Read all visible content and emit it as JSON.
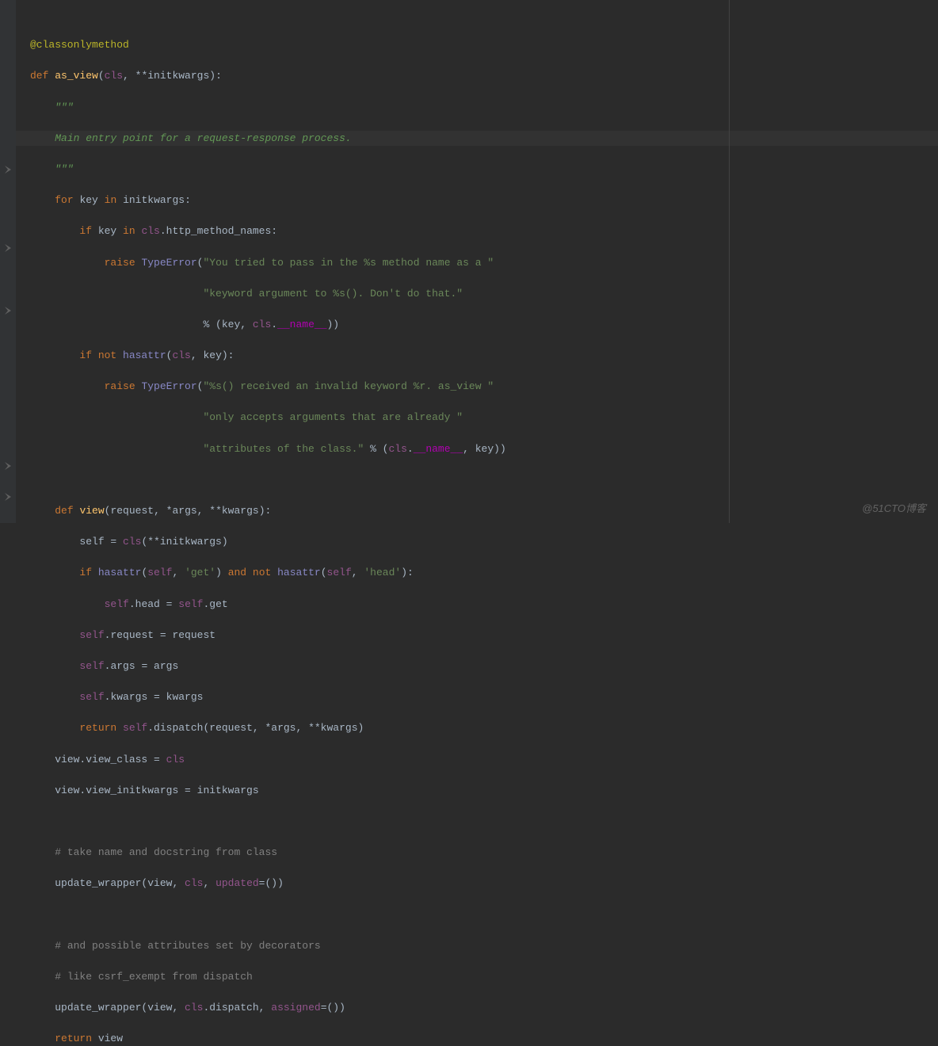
{
  "watermark": "@51CTO博客",
  "code": {
    "l1": "@classonlymethod",
    "l2_def": "def ",
    "l2_name": "as_view",
    "l2_params": "(",
    "l2_cls": "cls",
    "l2_rest": ", **initkwargs):",
    "l3": "\"\"\"",
    "l4": "Main entry point for a request-response process.",
    "l5": "\"\"\"",
    "l6_for": "for ",
    "l6_key": "key ",
    "l6_in": "in ",
    "l6_rest": "initkwargs:",
    "l7_if": "if ",
    "l7_key": "key ",
    "l7_in": "in ",
    "l7_cls": "cls",
    "l7_rest": ".http_method_names:",
    "l8_raise": "raise ",
    "l8_type": "TypeError",
    "l8_paren": "(",
    "l8_str": "\"You tried to pass in the %s method name as a \"",
    "l9_str": "\"keyword argument to %s(). Don't do that.\"",
    "l10_pct": "% (key, ",
    "l10_cls": "cls",
    "l10_dot": ".",
    "l10_name": "__name__",
    "l10_end": "))",
    "l11_if": "if not ",
    "l11_hasattr": "hasattr",
    "l11_paren": "(",
    "l11_cls": "cls",
    "l11_rest": ", key):",
    "l12_raise": "raise ",
    "l12_type": "TypeError",
    "l12_paren": "(",
    "l12_str": "\"%s() received an invalid keyword %r. as_view \"",
    "l13_str": "\"only accepts arguments that are already \"",
    "l14_str": "\"attributes of the class.\"",
    "l14_pct": " % (",
    "l14_cls": "cls",
    "l14_dot": ".",
    "l14_name": "__name__",
    "l14_end": ", key))",
    "l16_def": "def ",
    "l16_name": "view",
    "l16_params": "(request, *args, **kwargs):",
    "l17_self": "self = ",
    "l17_cls": "cls",
    "l17_rest": "(**initkwargs)",
    "l18_if": "if ",
    "l18_hasattr1": "hasattr",
    "l18_p1": "(",
    "l18_self1": "self",
    "l18_c1": ", ",
    "l18_str1": "'get'",
    "l18_p1c": ") ",
    "l18_and": "and not ",
    "l18_hasattr2": "hasattr",
    "l18_p2": "(",
    "l18_self2": "self",
    "l18_c2": ", ",
    "l18_str2": "'head'",
    "l18_p2c": "):",
    "l19_self": "self",
    "l19_rest1": ".head = ",
    "l19_self2": "self",
    "l19_rest2": ".get",
    "l20_self": "self",
    "l20_rest": ".request = request",
    "l21_self": "self",
    "l21_rest": ".args = args",
    "l22_self": "self",
    "l22_rest": ".kwargs = kwargs",
    "l23_return": "return ",
    "l23_self": "self",
    "l23_rest": ".dispatch(request, *args, **kwargs)",
    "l24_prefix": "view.view_class = ",
    "l24_cls": "cls",
    "l25": "view.view_initkwargs = initkwargs",
    "l27": "# take name and docstring from class",
    "l28_prefix": "update_wrapper(view, ",
    "l28_cls": "cls",
    "l28_c": ", ",
    "l28_upd": "updated",
    "l28_end": "=())",
    "l30": "# and possible attributes set by decorators",
    "l31": "# like csrf_exempt from dispatch",
    "l32_prefix": "update_wrapper(view, ",
    "l32_cls": "cls",
    "l32_disp": ".dispatch, ",
    "l32_asn": "assigned",
    "l32_end": "=())",
    "l33_return": "return ",
    "l33_rest": "view"
  }
}
